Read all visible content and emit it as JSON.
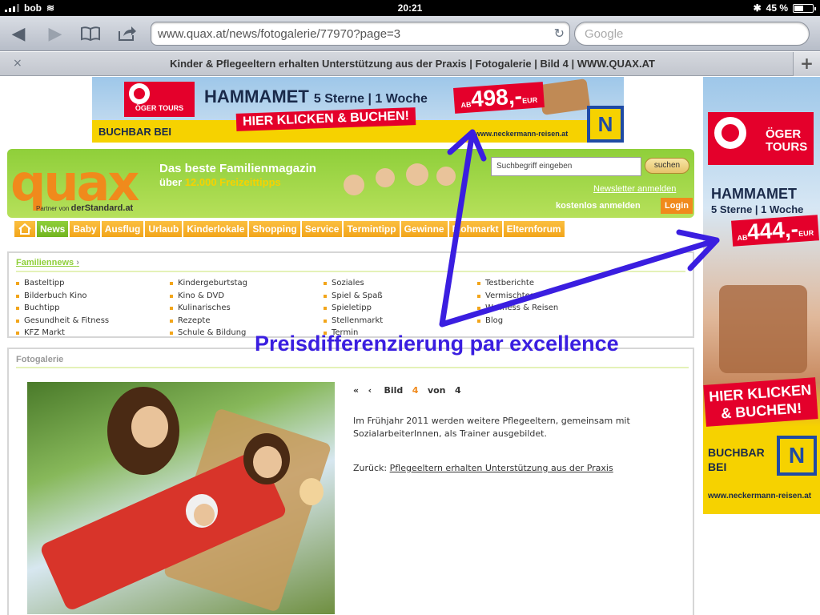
{
  "status_bar": {
    "carrier": "bob",
    "time": "20:21",
    "battery": "45 %"
  },
  "browser": {
    "url": "www.quax.at/news/fotogalerie/77970?page=3",
    "search_placeholder": "Google",
    "tab_title": "Kinder & Pflegeeltern erhalten Unterstützung aus der Praxis | Fotogalerie | Bild 4 | WWW.QUAX.AT",
    "tab_close": "×",
    "new_tab": "+"
  },
  "ad_top": {
    "brand": "ÖGER TOURS",
    "headline": "HAMMAMET",
    "subline": "5 Sterne | 1 Woche",
    "price_prefix": "AB",
    "price": "498,-",
    "currency": "EUR",
    "cta": "HIER KLICKEN & BUCHEN!",
    "buchbar": "BUCHBAR BEI",
    "site": "www.neckermann-reisen.at",
    "partner_logo": "N"
  },
  "ad_side": {
    "brand": "ÖGER TOURS",
    "headline": "HAMMAMET",
    "subline": "5 Sterne | 1 Woche",
    "price_prefix": "AB",
    "price": "444,-",
    "currency": "EUR",
    "cta": "HIER KLICKEN & BUCHEN!",
    "buchbar": "BUCHBAR BEI",
    "site": "www.neckermann-reisen.at",
    "partner_logo": "N"
  },
  "quax": {
    "logo": "quax",
    "partner_prefix": "Partner von",
    "partner": "derStandard.at",
    "tagline": "Das beste Familienmagazin",
    "tagline2_prefix": "über",
    "tagline2_highlight": "12.000 Freizeittipps",
    "search_placeholder": "Suchbegriff eingeben",
    "search_button": "suchen",
    "newsletter": "Newsletter anmelden",
    "register": "kostenlos anmelden",
    "login": "Login"
  },
  "nav": [
    "News",
    "Baby",
    "Ausflug",
    "Urlaub",
    "Kinderlokale",
    "Shopping",
    "Service",
    "Termintipp",
    "Gewinne",
    "Flohmarkt",
    "Elternforum"
  ],
  "familiennews": {
    "title": "Familiennews",
    "arrow": "›",
    "col1": [
      "Basteltipp",
      "Bilderbuch Kino",
      "Buchtipp",
      "Gesundheit & Fitness",
      "KFZ Markt"
    ],
    "col2": [
      "Kindergeburtstag",
      "Kino & DVD",
      "Kulinarisches",
      "Rezepte",
      "Schule & Bildung"
    ],
    "col3": [
      "Soziales",
      "Spiel & Spaß",
      "Spieletipp",
      "Stellenmarkt",
      "Termin"
    ],
    "col4": [
      "Testberichte",
      "Vermischtes",
      "Wellness & Reisen",
      "Blog"
    ]
  },
  "fotogalerie": {
    "title": "Fotogalerie",
    "pager_first": "«",
    "pager_prev": "‹",
    "pager_label": "Bild",
    "pager_current": "4",
    "pager_of": "von",
    "pager_total": "4",
    "caption": "Im Frühjahr 2011 werden weitere Pflegeeltern, gemeinsam mit SozialarbeiterInnen, als Trainer ausgebildet.",
    "back_label": "Zurück:",
    "back_link": "Pflegeeltern erhalten Unterstützung aus der Praxis"
  },
  "annotation": {
    "text": "Preisdifferenzierung par excellence",
    "color": "#3a1ee0"
  },
  "colors": {
    "quax_green": "#8fcf3a",
    "quax_orange": "#f08a1c",
    "ad_red": "#e4002b",
    "ad_yellow": "#f6d200"
  }
}
